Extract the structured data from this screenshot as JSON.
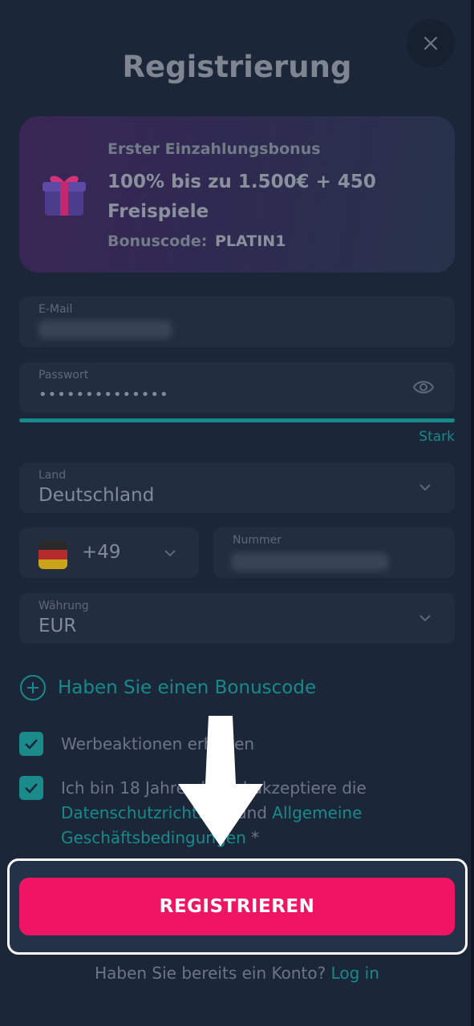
{
  "header": {
    "title": "Registrierung",
    "close_icon": "close-icon"
  },
  "bonus": {
    "subtitle": "Erster Einzahlungsbonus",
    "headline": "100% bis zu 1.500€ + 450 Freispiele",
    "code_label": "Bonuscode:",
    "code_value": "PLATIN1",
    "icon": "gift-icon"
  },
  "form": {
    "email": {
      "label": "E-Mail",
      "value": ""
    },
    "password": {
      "label": "Passwort",
      "value": "••••••••••••••",
      "strength": "Stark",
      "toggle_icon": "eye-icon"
    },
    "country": {
      "label": "Land",
      "value": "Deutschland"
    },
    "phone": {
      "prefix": "+49",
      "number_label": "Nummer",
      "number_value": ""
    },
    "currency": {
      "label": "Währung",
      "value": "EUR"
    }
  },
  "promo_code_link": "Haben Sie einen Bonuscode",
  "checkboxes": {
    "marketing": {
      "label": "Werbeaktionen erhalten",
      "checked": true
    },
    "terms": {
      "text_start": "Ich bin 18 Jahre alt und akzeptiere die ",
      "privacy_link": "Datenschutzrichtlinie",
      "and": " und ",
      "terms_link": "Allgemeine Geschäftsbedingungen",
      "required_mark": " *",
      "checked": true
    }
  },
  "register_button": "REGISTRIEREN",
  "login": {
    "prompt": "Haben Sie bereits ein Konto?",
    "link": "Log in"
  },
  "colors": {
    "accent": "#178a8a",
    "primary_button": "#ef1564",
    "background": "#1b2638",
    "field": "#222d40"
  }
}
